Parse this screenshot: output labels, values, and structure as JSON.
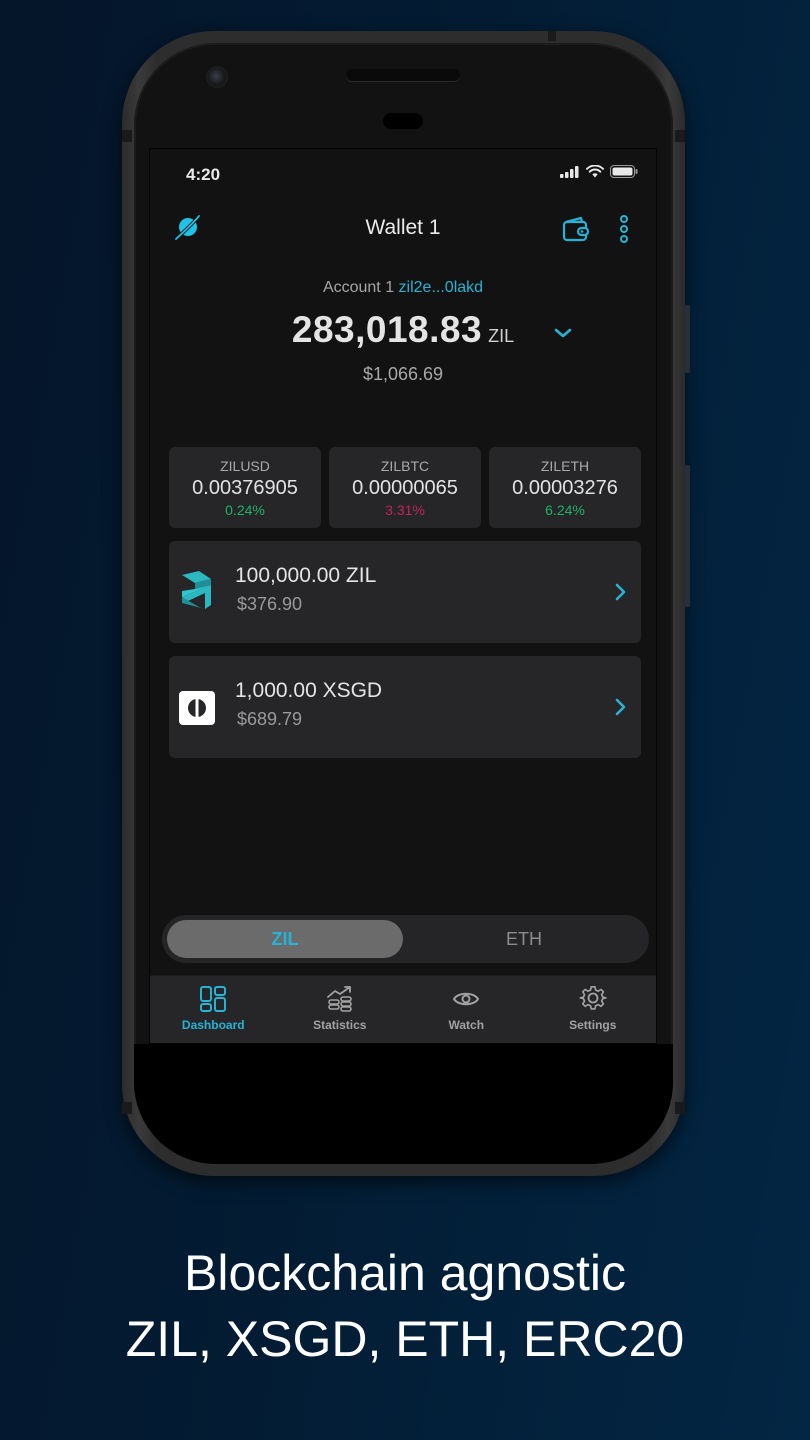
{
  "status_bar": {
    "time": "4:20"
  },
  "header": {
    "title": "Wallet 1"
  },
  "account": {
    "label": "Account 1",
    "address_short": "zil2e...0lakd",
    "balance": "283,018.83",
    "balance_unit": "ZIL",
    "fiat_value": "$1,066.69"
  },
  "rates": [
    {
      "pair": "ZILUSD",
      "value": "0.00376905",
      "change": "0.24%",
      "direction": "up"
    },
    {
      "pair": "ZILBTC",
      "value": "0.00000065",
      "change": "3.31%",
      "direction": "down"
    },
    {
      "pair": "ZILETH",
      "value": "0.00003276",
      "change": "6.24%",
      "direction": "up"
    }
  ],
  "tokens": [
    {
      "icon": "zilliqa-logo-icon",
      "amount": "100,000.00 ZIL",
      "fiat": "$376.90"
    },
    {
      "icon": "xsgd-logo-icon",
      "amount": "1,000.00 XSGD",
      "fiat": "$689.79"
    }
  ],
  "network_switch": {
    "options": [
      {
        "label": "ZIL",
        "selected": true
      },
      {
        "label": "ETH",
        "selected": false
      }
    ]
  },
  "tabbar": {
    "items": [
      {
        "label": "Dashboard",
        "icon": "dashboard-icon",
        "active": true
      },
      {
        "label": "Statistics",
        "icon": "statistics-icon",
        "active": false
      },
      {
        "label": "Watch",
        "icon": "eye-icon",
        "active": false
      },
      {
        "label": "Settings",
        "icon": "gear-icon",
        "active": false
      }
    ]
  },
  "colors": {
    "accent": "#27b3d6",
    "positive": "#1db36a",
    "negative": "#c2255c",
    "card": "#262628",
    "screen_bg": "#121212"
  },
  "caption": {
    "line1": "Blockchain agnostic",
    "line2": "ZIL, XSGD, ETH, ERC20"
  }
}
